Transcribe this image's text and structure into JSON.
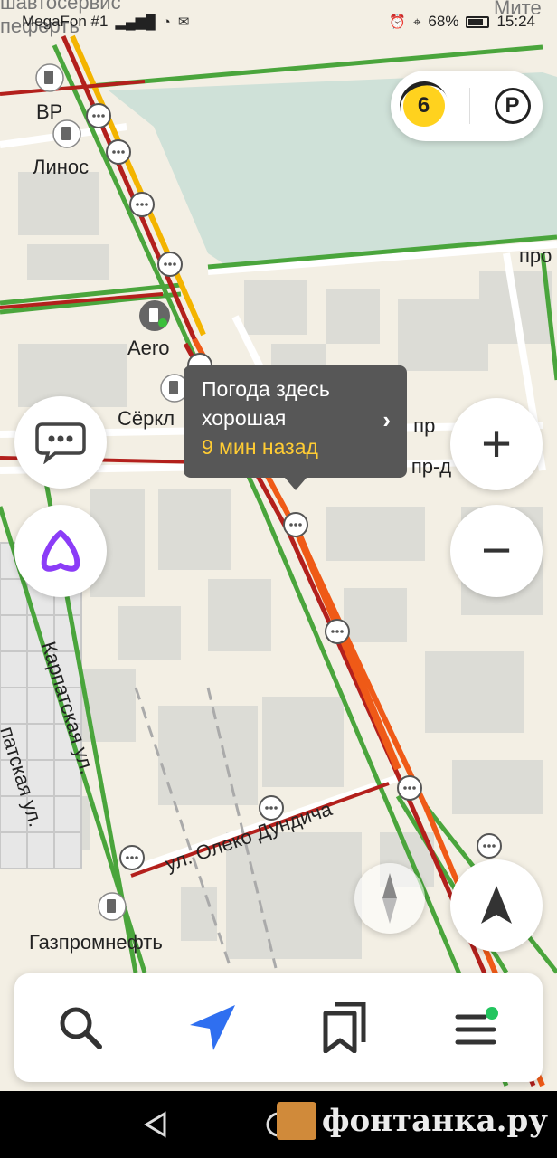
{
  "status_bar": {
    "carrier": "MegaFon #1",
    "battery": "68%",
    "time": "15:24"
  },
  "map": {
    "labels": {
      "top_left_fragment_1": "шавтосервис",
      "top_left_fragment_2": "пеферть",
      "top_right_fragment": "Мите",
      "bp": "BP",
      "linos": "Линос",
      "aero": "Aero",
      "circle_k": "Сёркл",
      "skladskoy": "Складской пр",
      "gruzovoy": "Грузовой пр-д",
      "pr_fragment": "про",
      "karpatskaya_1": "Карпатская ул.",
      "karpatskaya_2": "патская ул.",
      "oleko_dundicha": "ул. Олеко Дундича",
      "gazpromneft": "Газпромнефть"
    }
  },
  "traffic": {
    "level": "6",
    "parking_label": "P"
  },
  "tooltip": {
    "line1": "Погода здесь",
    "line2": "хорошая",
    "time": "9 мин назад"
  },
  "zoom": {
    "in_label": "+",
    "out_label": "−"
  },
  "bottom_bar": {
    "items": [
      "search-icon",
      "navigation-arrow-icon",
      "bookmarks-icon",
      "menu-icon"
    ]
  },
  "watermark": {
    "text": "фонтанка.ру"
  },
  "colors": {
    "traffic_green": "#4aa53c",
    "traffic_red": "#b3201c",
    "traffic_orange": "#ef5a17",
    "traffic_yellow": "#f3b400",
    "accent_purple": "#8b3cf7",
    "nav_blue": "#2f6ff0"
  }
}
